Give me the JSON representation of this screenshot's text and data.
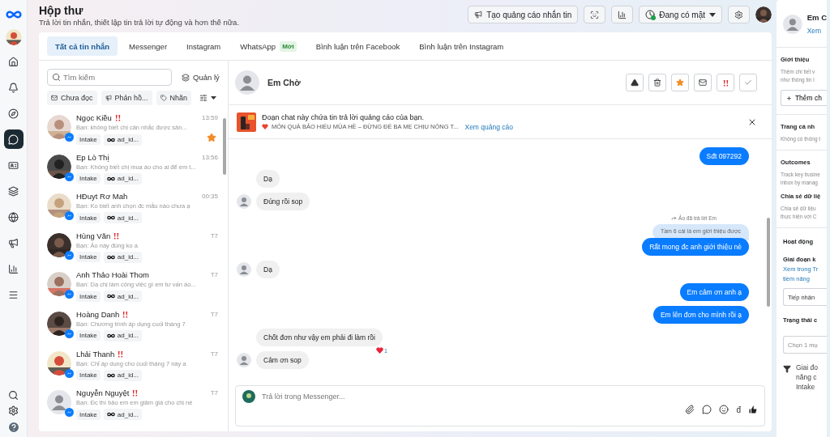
{
  "rail": [
    {
      "selected": false
    },
    {
      "selected": false
    },
    {
      "selected": false
    },
    {
      "selected": true
    },
    {
      "selected": false
    },
    {
      "selected": false
    },
    {
      "selected": false
    },
    {
      "selected": false
    },
    {
      "selected": false
    },
    {
      "selected": false
    }
  ],
  "header": {
    "title": "Hộp thư",
    "subtitle": "Trả lời tin nhắn, thiết lập tin trả lời tự động và hơn thế nữa.",
    "ad_button": "Tạo quảng cáo nhắn tin",
    "status": {
      "label": "Đang có mặt",
      "online": true
    }
  },
  "tabs": [
    {
      "label": "Tất cả tin nhắn",
      "selected": true
    },
    {
      "label": "Messenger",
      "selected": false
    },
    {
      "label": "Instagram",
      "selected": false
    },
    {
      "label": "WhatsApp",
      "badge": "Mới",
      "selected": false
    },
    {
      "label": "Bình luận trên Facebook",
      "selected": false
    },
    {
      "label": "Bình luận trên Instagram",
      "selected": false
    }
  ],
  "search": {
    "placeholder": "Tìm kiếm"
  },
  "manage_button": "Quản lý",
  "filters": [
    {
      "kind": "unread",
      "label": "Chưa đọc"
    },
    {
      "kind": "reply",
      "label": "Phản hồ..."
    },
    {
      "kind": "label",
      "label": "Nhãn"
    }
  ],
  "conversations": [
    {
      "name": "Ngọc Kiều",
      "flagged": true,
      "preview": "Bạn: không biết chị cân nhắc được sản...",
      "time": "13:59",
      "starred": true,
      "has_photo": true,
      "tags": [
        "Intake",
        "ad_id..."
      ]
    },
    {
      "name": "Ep Lò Thị",
      "flagged": false,
      "preview": "Bạn: Không biết chị mua áo cho ai để em t...",
      "time": "13:56",
      "starred": false,
      "has_photo": true,
      "tags": [
        "Intake",
        "ad_id..."
      ]
    },
    {
      "name": "HĐuyt Rơ Mah",
      "flagged": false,
      "preview": "Bạn: Ko biết anh chọn đc mẫu nào chưa ạ",
      "time": "00:35",
      "starred": false,
      "has_photo": true,
      "tags": [
        "Intake",
        "ad_id..."
      ]
    },
    {
      "name": "Hùng Văn",
      "flagged": true,
      "preview": "Bạn: Áo này đúng ko a",
      "time": "T7",
      "starred": false,
      "has_photo": true,
      "tags": [
        "Intake",
        "ad_id..."
      ]
    },
    {
      "name": "Anh Thảo Hoài Thom",
      "flagged": false,
      "preview": "Bạn: Dạ chị làm công việc gì em tư vấn áo...",
      "time": "T7",
      "starred": false,
      "has_photo": true,
      "tags": [
        "Intake",
        "ad_id..."
      ]
    },
    {
      "name": "Hoàng Danh",
      "flagged": true,
      "preview": "Bạn: Chương trình áp dụng cuối tháng 7",
      "time": "T7",
      "starred": false,
      "has_photo": true,
      "tags": [
        "Intake",
        "ad_id..."
      ]
    },
    {
      "name": "Lhải Thanh",
      "flagged": true,
      "preview": "Bạn: Chỉ áp dụng cho cuối tháng 7 này a",
      "time": "T7",
      "starred": false,
      "has_photo": true,
      "tags": [
        "Intake",
        "ad_id..."
      ]
    },
    {
      "name": "Nguyễn Nguyệt",
      "flagged": true,
      "preview": "Bạn: Đc thì bảo em em giảm giá cho chị nè",
      "time": "T7",
      "starred": false,
      "has_photo": false,
      "tags": [
        "Intake",
        "ad_id..."
      ]
    }
  ],
  "chat": {
    "name": "Em Chờ",
    "banner": {
      "title": "Đoạn chat này chứa tin trả lời quảng cáo của bạn.",
      "ad_text": "MÓN QUÀ BẢO HIỂU MÙA HÈ – ĐỪNG ĐỂ BA MẸ CHỊU NÓNG T...",
      "link": "Xem quảng cáo"
    },
    "messages": [
      {
        "kind": "outgoing",
        "text": "Sđt 097292"
      },
      {
        "kind": "incoming",
        "text": "Dạ",
        "avatar": false
      },
      {
        "kind": "incoming",
        "text": "Đúng rồi sop",
        "avatar": true
      },
      {
        "kind": "reply",
        "note": "Ảo đã trả lời Em",
        "quote": "Tầm 6 cái là em giới thiệu được",
        "text": "Rất mong đc anh giới thiệu nè"
      },
      {
        "kind": "incoming",
        "text": "Dạ",
        "avatar": true
      },
      {
        "kind": "outgoing",
        "text": "Em cảm ơn anh ạ"
      },
      {
        "kind": "outgoing",
        "text": "Em lên đơn cho mình rồi ạ"
      },
      {
        "kind": "incoming",
        "text": "Chốt đơn như vậy em phải đi làm rồi",
        "avatar": false,
        "reaction": "1"
      },
      {
        "kind": "incoming",
        "text": "Cảm ơn sop",
        "avatar": true
      }
    ],
    "composer": {
      "placeholder": "Trả lời trong Messenger...",
      "currency": "đ"
    }
  },
  "profile": {
    "name": "Em C",
    "link": "Xem",
    "sections": [
      {
        "kind": "intro",
        "title": "Giới thiệu",
        "lines": [
          "Thêm chi tiết v",
          "như thông tin l"
        ],
        "button": "Thêm ch"
      },
      {
        "kind": "plain",
        "title": "Trang cá nh",
        "lines": [
          "Không có thông t"
        ]
      },
      {
        "kind": "outcomes",
        "title": "Outcomes",
        "lines": [
          "Track key busine",
          "inbox by manag"
        ],
        "subtitle": "Chia sẻ dữ liệ",
        "sublines": [
          "Chia sẻ dữ liệu",
          "thực hiện với C"
        ]
      }
    ],
    "activity": {
      "title": "Hoạt động",
      "stage_label": "Giai đoạn k",
      "stage_link": [
        "Xem trong Tr",
        "tiềm năng"
      ],
      "stage_value": "Tiếp nhận",
      "state_label": "Trạng thái c",
      "state_placeholder": "Chọn 1 mụ",
      "note": [
        "Giai đo",
        "năng c",
        "Intake"
      ]
    }
  }
}
